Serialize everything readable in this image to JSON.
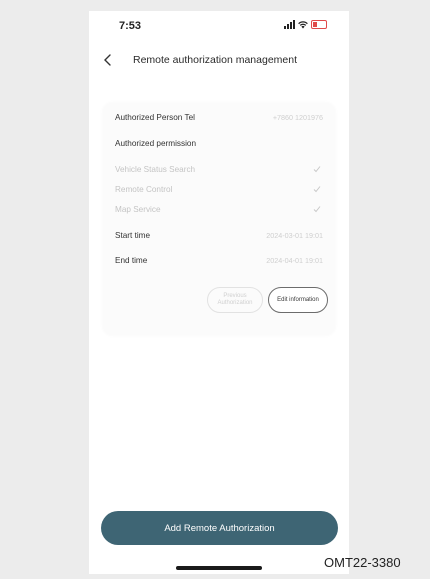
{
  "status_bar": {
    "time": "7:53"
  },
  "nav": {
    "title": "Remote authorization management"
  },
  "card": {
    "authorized_person_label": "Authorized Person Tel",
    "authorized_person_value": "+7860 1201976",
    "permission_header": "Authorized permission",
    "permissions": [
      {
        "label": "Vehicle Status Search"
      },
      {
        "label": "Remote Control"
      },
      {
        "label": "Map Service"
      }
    ],
    "start_label": "Start time",
    "start_value": "2024-03-01 19:01",
    "end_label": "End time",
    "end_value": "2024-04-01 19:01",
    "previous_button": "Previous Authorization",
    "edit_button": "Edit information"
  },
  "add_button": "Add Remote Authorization",
  "reference_code": "OMT22-3380",
  "colors": {
    "accent": "#3e6574",
    "disabled_text": "#c4c4c4"
  }
}
